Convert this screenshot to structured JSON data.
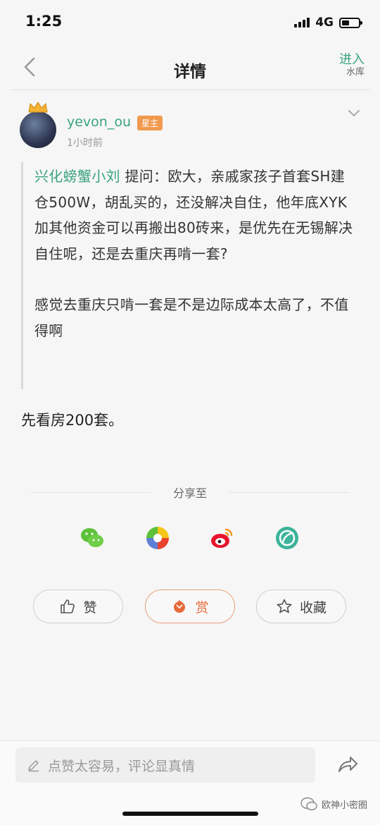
{
  "status": {
    "time": "1:25",
    "network": "4G"
  },
  "nav": {
    "title": "详情",
    "enter_label": "进入",
    "enter_sub": "水库"
  },
  "post": {
    "author": "yevon_ou",
    "badge": "星主",
    "time": "1小时前",
    "question_user": "兴化螃蟹小刘",
    "question_para1": " 提问：欧大，亲戚家孩子首套SH建仓500W，胡乱买的，还没解决自住，他年底XYK加其他资金可以再搬出80砖来，是优先在无锡解决自住呢，还是去重庆再啃一套?",
    "question_para2": "感觉去重庆只啃一套是不是边际成本太高了，不值得啊",
    "answer": "先看房200套。"
  },
  "share": {
    "label": "分享至",
    "icons": [
      "wechat-icon",
      "moments-icon",
      "weibo-icon",
      "qzone-icon"
    ]
  },
  "actions": {
    "like": "赞",
    "reward": "赏",
    "favorite": "收藏"
  },
  "comment": {
    "placeholder": "点赞太容易，评论显真情"
  },
  "watermark": {
    "text": "欧神小密圈"
  },
  "colors": {
    "accent": "#3aa37f",
    "badge": "#f19a4e",
    "reward": "#e76a3c"
  }
}
